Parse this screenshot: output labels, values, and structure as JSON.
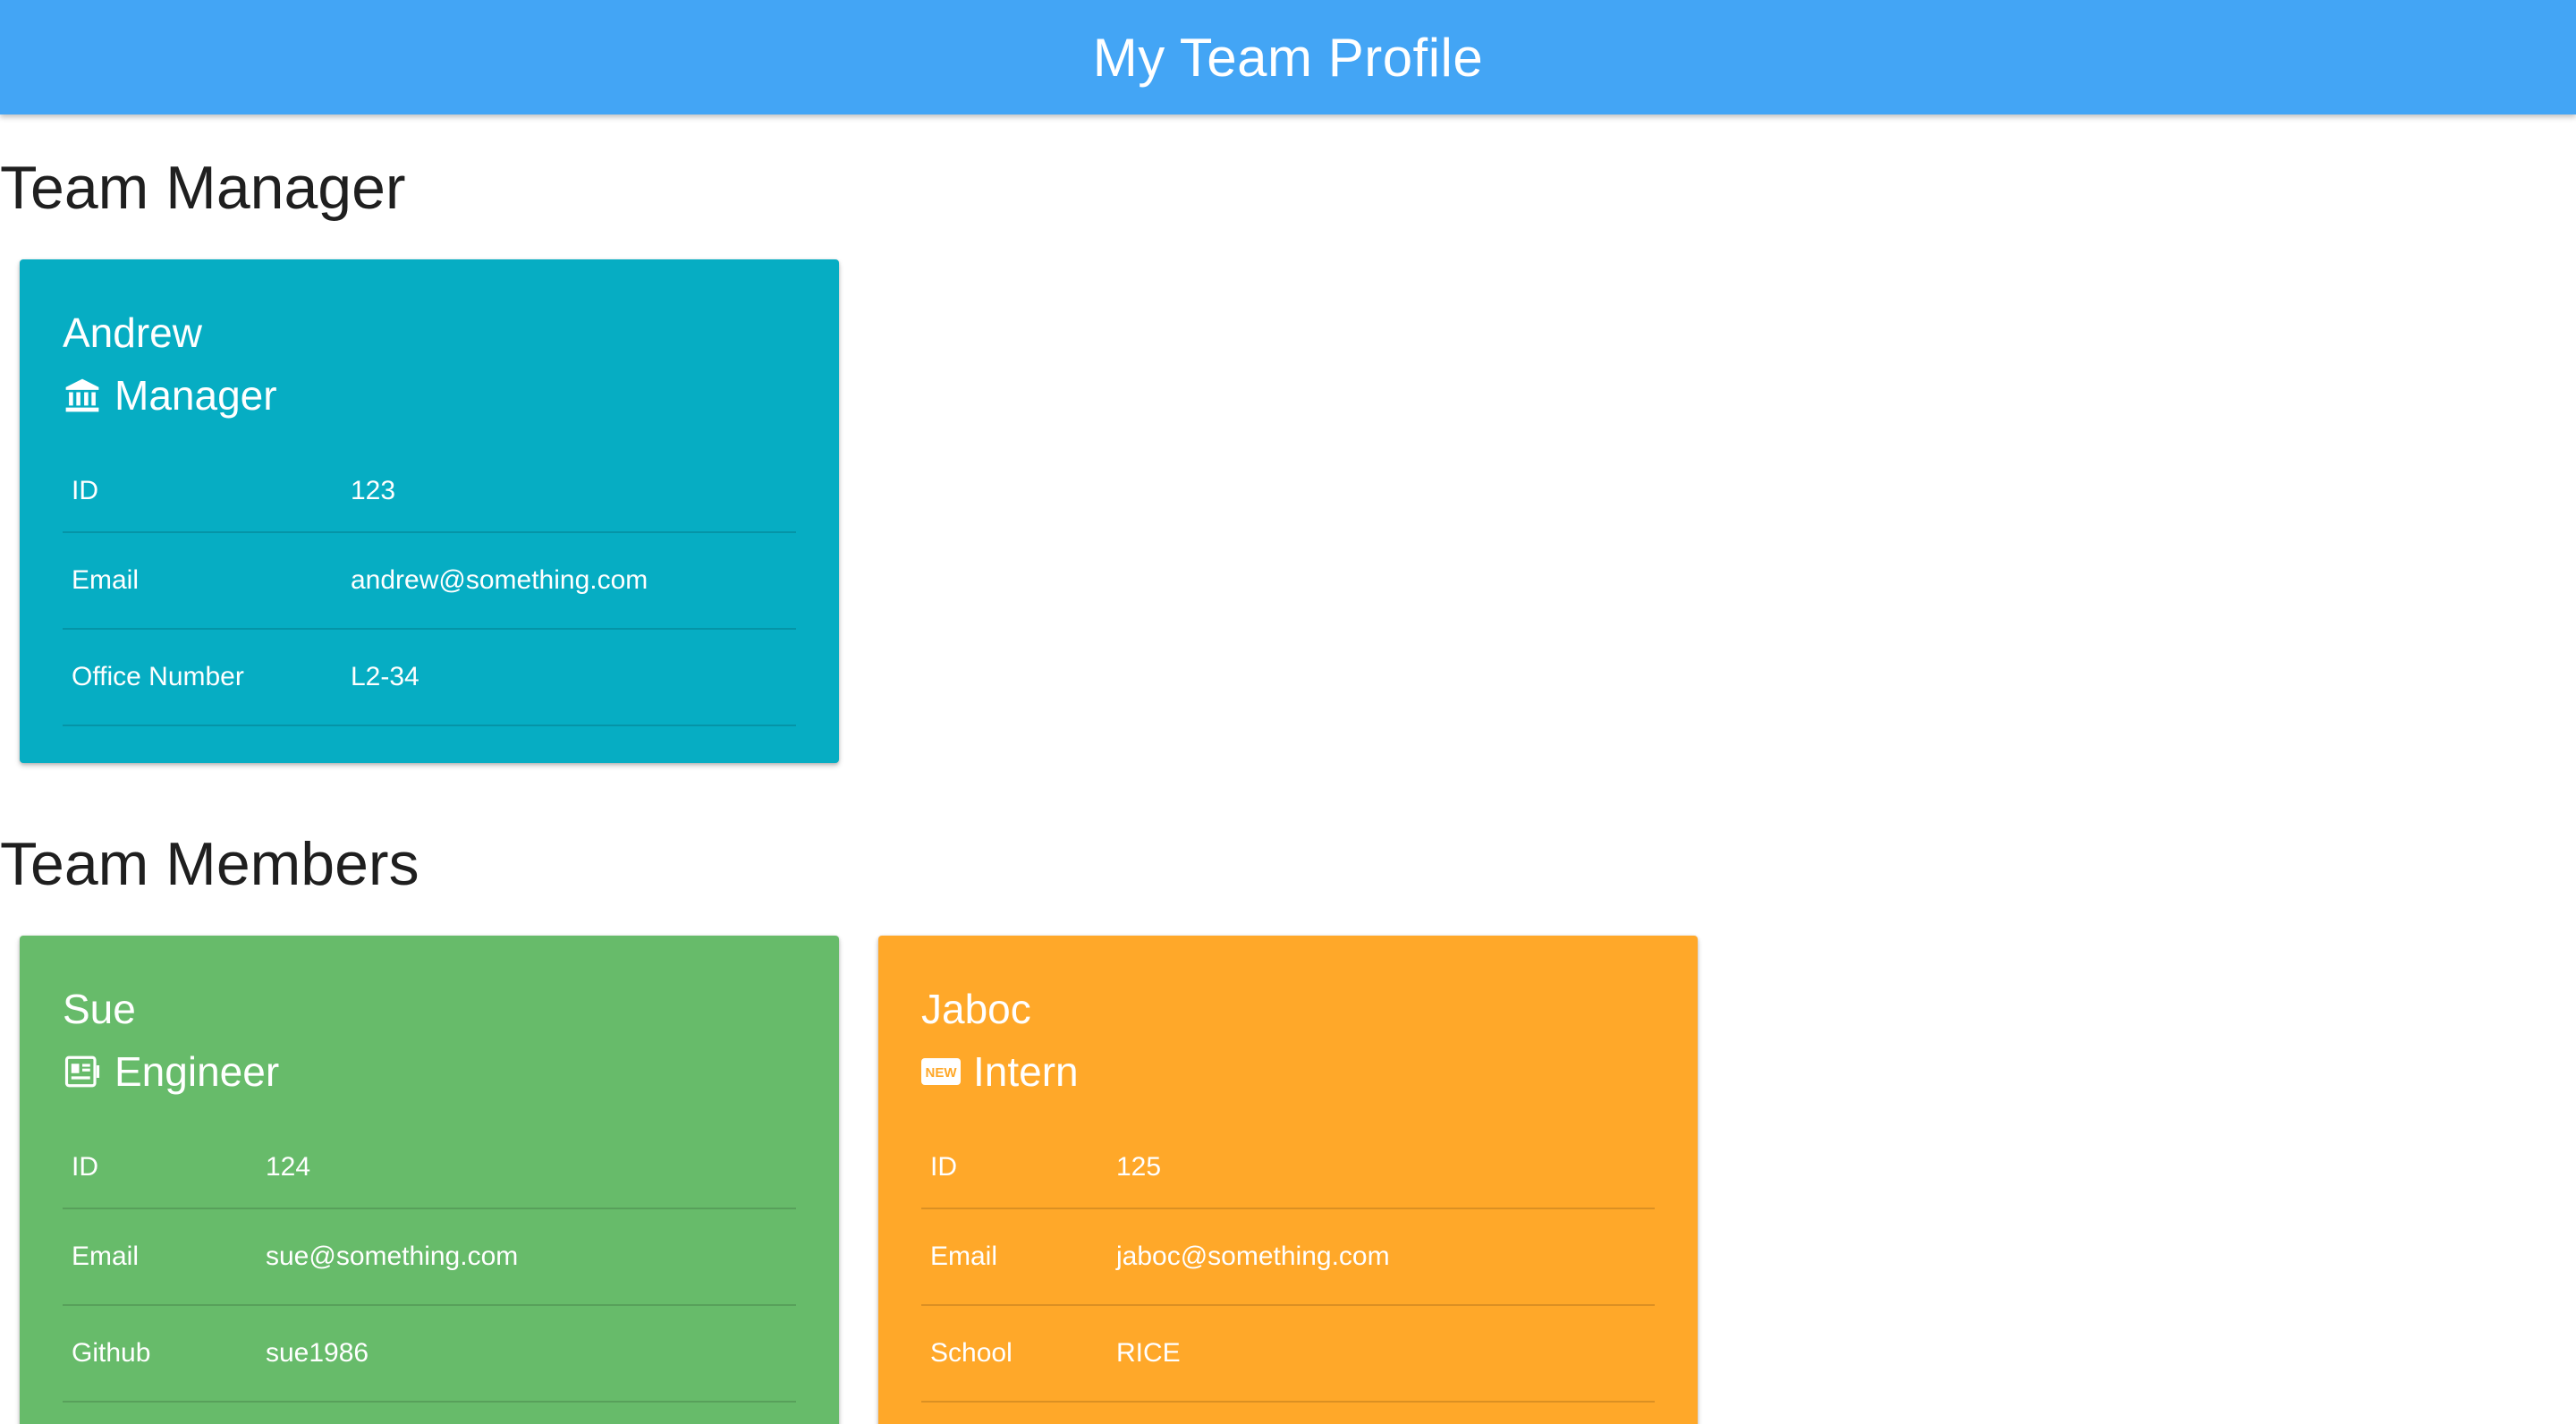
{
  "header": {
    "title": "My Team Profile",
    "background": "#43a5f5"
  },
  "sections": {
    "manager_title": "Team Manager",
    "members_title": "Team Members"
  },
  "manager": {
    "name": "Andrew",
    "role": "Manager",
    "icon": "bank-icon",
    "color": "#06adc3",
    "fields": [
      {
        "label": "ID",
        "value": "123"
      },
      {
        "label": "Email",
        "value": "andrew@something.com"
      },
      {
        "label": "Office Number",
        "value": "L2-34"
      }
    ]
  },
  "members": [
    {
      "name": "Sue",
      "role": "Engineer",
      "icon": "id-card-icon",
      "color": "#67bb6a",
      "fields": [
        {
          "label": "ID",
          "value": "124"
        },
        {
          "label": "Email",
          "value": "sue@something.com"
        },
        {
          "label": "Github",
          "value": "sue1986"
        }
      ]
    },
    {
      "name": "Jaboc",
      "role": "Intern",
      "icon": "new-badge-icon",
      "icon_text": "NEW",
      "color": "#ffa829",
      "fields": [
        {
          "label": "ID",
          "value": "125"
        },
        {
          "label": "Email",
          "value": "jaboc@something.com"
        },
        {
          "label": "School",
          "value": "RICE"
        }
      ]
    }
  ]
}
